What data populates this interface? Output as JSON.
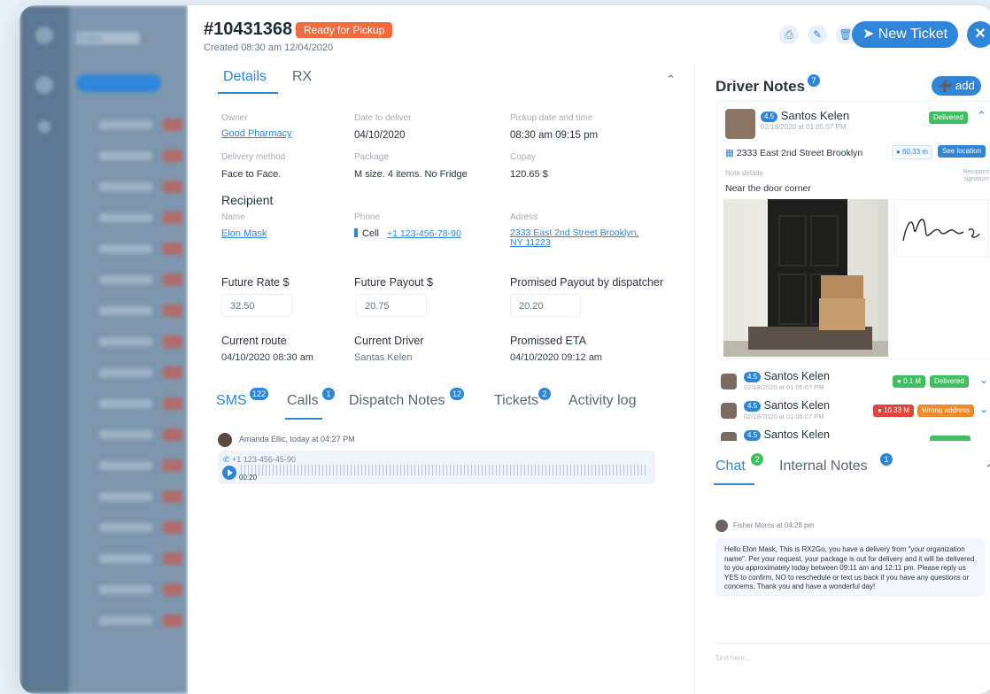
{
  "background_app": {
    "title": "Orders"
  },
  "header": {
    "order_id": "#10431368",
    "status_badge": "Ready for Pickup",
    "created": "Created 08:30 am 12/04/2020",
    "new_ticket_label": "New Ticket",
    "close_label": "✕",
    "icons": [
      "print-icon",
      "edit-icon",
      "trash-icon"
    ]
  },
  "details_tabs": {
    "items": [
      {
        "label": "Details",
        "active": true
      },
      {
        "label": "RX",
        "active": false
      }
    ]
  },
  "details": {
    "owner_label": "Owner",
    "owner_value": "Good Pharmacy",
    "date_label": "Date to deliver",
    "date_value": "04/10/2020",
    "pickup_label": "Pickup date and time",
    "pickup_value": "08:30 am 09:15 pm",
    "method_label": "Delivery method",
    "method_value": "Face to Face.",
    "package_label": "Package",
    "package_value": "M size. 4 items. No Fridge",
    "copay_label": "Copay",
    "copay_value": "120.65 $"
  },
  "recipient": {
    "title": "Recipient",
    "name_label": "Name",
    "name_value": "Elon Mask",
    "phone_label": "Phone",
    "phone_type": "Cell",
    "phone_value": "+1 123-456-78-90",
    "address_label": "Adress",
    "address_line1": "2333 East 2nd Street Brooklyn,",
    "address_line2": "NY 11223"
  },
  "rates": {
    "future_rate_label": "Future Rate $",
    "future_rate_value": "32.50",
    "future_payout_label": "Future Payout $",
    "future_payout_value": "20.75",
    "promised_payout_label": "Promised Payout by dispatcher",
    "promised_payout_value": "20.20"
  },
  "route": {
    "current_route_label": "Current route",
    "current_route_value": "04/10/2020 08:30 am",
    "current_driver_label": "Current Driver",
    "current_driver_value": "Santas Kelen",
    "eta_label": "Promissed ETA",
    "eta_value": "04/10/2020 09:12 am"
  },
  "bottom_tabs": {
    "items": [
      {
        "label": "SMS",
        "count": "122"
      },
      {
        "label": "Calls",
        "count": "1",
        "active": true
      },
      {
        "label": "Dispatch Notes",
        "count": "12"
      },
      {
        "label": "Tickets",
        "count": "2"
      },
      {
        "label": "Activity log",
        "count": ""
      }
    ]
  },
  "call": {
    "author": "Amanda Ellic, today at 04:27 PM",
    "number": "+1 123-456-45-90",
    "duration": "00:20"
  },
  "driver_notes": {
    "title": "Driver Notes",
    "count": "7",
    "add_label": "add",
    "main_note": {
      "rating": "4.5",
      "name": "Santos Kelen",
      "date": "02/18/2020 at 01:05:07 PM",
      "status": "Delivered",
      "address": "2333 East 2nd Street Brooklyn",
      "distance": "60,33 m",
      "see_location": "See location",
      "note_label": "Note details",
      "signature_label": "Recipient signature",
      "note_text": "Near the door corner"
    },
    "other_notes": [
      {
        "rating": "4.5",
        "name": "Santos Kelen",
        "date": "02/18/2020 at 01:05:07 PM",
        "distance": "0.1 M",
        "status": "Delivered",
        "status_color": "green"
      },
      {
        "rating": "4.5",
        "name": "Santos Kelen",
        "date": "02/18/2020 at 01:05:07 PM",
        "distance": "10.33 M",
        "status": "Wrong address",
        "status_color": "orange"
      },
      {
        "rating": "4.5",
        "name": "Santos Kelen",
        "date": "",
        "distance": "",
        "status": "",
        "status_color": "green"
      }
    ]
  },
  "chat": {
    "tabs": [
      {
        "label": "Chat",
        "count": "2",
        "active": true
      },
      {
        "label": "Internal Notes",
        "count": "1",
        "active": false
      }
    ],
    "author": "Fisher Morris at 04:28 pm",
    "message": "Hello Elon Mask, This is RX2Go, you have a delivery from \"your organization name\". Per your request, your package is out for delivery and it will be delivered to you approximately today between 09:11 am and 12:11 pm. Please reply us YES to confirm, NO to reschedule or text us back if you have any questions or concerns. Thank you and have a wonderful day!",
    "input_placeholder": "Text here..."
  }
}
